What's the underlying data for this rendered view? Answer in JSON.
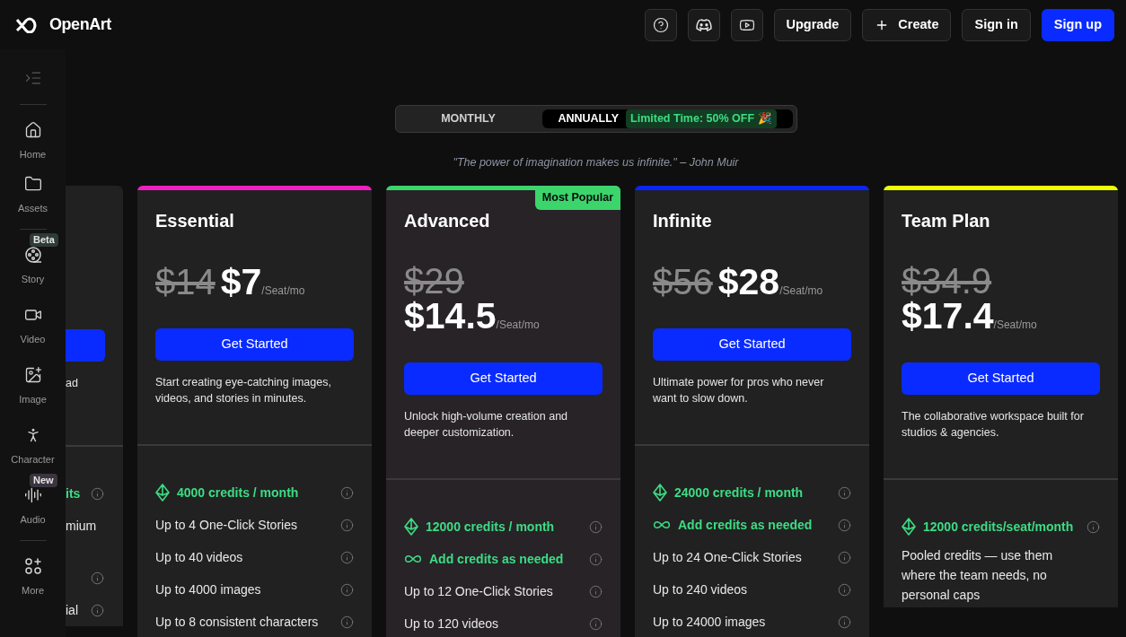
{
  "header": {
    "logo": "OpenArt",
    "icon_buttons": [
      {
        "kind": "help"
      },
      {
        "kind": "discord"
      },
      {
        "kind": "video"
      }
    ],
    "buttons": [
      {
        "label": "Upgrade",
        "kind": "outline"
      },
      {
        "label": "Create",
        "kind": "create"
      },
      {
        "label": "Sign in",
        "kind": "outline"
      },
      {
        "label": "Sign up",
        "kind": "primary"
      }
    ]
  },
  "sidebar": {
    "groups": [
      [
        {
          "label": "Home",
          "kind": "home"
        },
        {
          "label": "Assets",
          "kind": "folder"
        }
      ],
      [
        {
          "label": "Story",
          "kind": "reel",
          "badge": {
            "text": "Beta",
            "color": "#2f3b35"
          }
        },
        {
          "label": "Video",
          "kind": "video"
        },
        {
          "label": "Image",
          "kind": "image"
        },
        {
          "label": "Character",
          "kind": "person"
        },
        {
          "label": "Audio",
          "kind": "audio",
          "badge": {
            "text": "New",
            "color": "#3b3440"
          }
        }
      ],
      [
        {
          "label": "More",
          "kind": "more"
        }
      ]
    ]
  },
  "billing_toggle": {
    "options": [
      {
        "label": "MONTHLY",
        "selected": false
      },
      {
        "label": "ANNUALLY",
        "selected": true,
        "promo": "Limited Time: 50% OFF 🎉"
      }
    ]
  },
  "quote": "\"The power of imagination makes us infinite.\" – John Muir",
  "partial_plan": {
    "description": "ad",
    "features": [
      {
        "kind": "credits",
        "text": "its",
        "info": true
      },
      {
        "kind": "plain",
        "text": "mium",
        "info": false
      },
      {
        "kind": "plain",
        "info": true
      },
      {
        "kind": "plain",
        "text": "ial",
        "info": true
      }
    ]
  },
  "plans": [
    {
      "name": "Essential",
      "color": "#f01fc0",
      "old_price": "$14",
      "price": "$7",
      "unit": "/Seat/mo",
      "cta": "Get Started",
      "description": "Start creating eye-catching images, videos, and stories in minutes.",
      "features": [
        {
          "kind": "credits",
          "text": "4000 credits / month",
          "info": true
        },
        {
          "kind": "plain",
          "text": "Up to 4 One-Click Stories",
          "info": true
        },
        {
          "kind": "plain",
          "text": "Up to 40 videos",
          "info": true
        },
        {
          "kind": "plain",
          "text": "Up to 4000 images",
          "info": true
        },
        {
          "kind": "plain",
          "text": "Up to 8 consistent characters",
          "info": true
        }
      ]
    },
    {
      "name": "Advanced",
      "color": "#3bd56c",
      "badge": "Most Popular",
      "old_price": "$29",
      "price": "$14.5",
      "unit": "/Seat/mo",
      "cta": "Get Started",
      "description": "Unlock high-volume creation and deeper customization.",
      "features": [
        {
          "kind": "credits",
          "text": "12000 credits / month",
          "info": true
        },
        {
          "kind": "topup",
          "text": "Add credits as needed",
          "info": true
        },
        {
          "kind": "plain",
          "text": "Up to 12 One-Click Stories",
          "info": true
        },
        {
          "kind": "plain",
          "text": "Up to 120 videos",
          "info": true
        }
      ]
    },
    {
      "name": "Infinite",
      "color": "#0a24ff",
      "old_price": "$56",
      "price": "$28",
      "unit": "/Seat/mo",
      "cta": "Get Started",
      "description": "Ultimate power for pros who never want to slow down.",
      "features": [
        {
          "kind": "credits",
          "text": "24000 credits / month",
          "info": true
        },
        {
          "kind": "topup",
          "text": "Add credits as needed",
          "info": true
        },
        {
          "kind": "plain",
          "text": "Up to 24 One-Click Stories",
          "info": true
        },
        {
          "kind": "plain",
          "text": "Up to 240 videos",
          "info": true
        },
        {
          "kind": "plain",
          "text": "Up to 24000 images",
          "info": true
        }
      ]
    },
    {
      "name": "Team Plan",
      "color": "#eeff00",
      "old_price": "$34.9",
      "price": "$17.4",
      "unit": "/Seat/mo",
      "cta": "Get Started",
      "description": "The collaborative workspace built for studios & agencies.",
      "features": [
        {
          "kind": "credits",
          "text": "12000 credits/seat/month",
          "info": true
        },
        {
          "kind": "plain",
          "text": "Pooled credits — use them where the team needs, no personal caps",
          "info": false
        }
      ]
    }
  ]
}
